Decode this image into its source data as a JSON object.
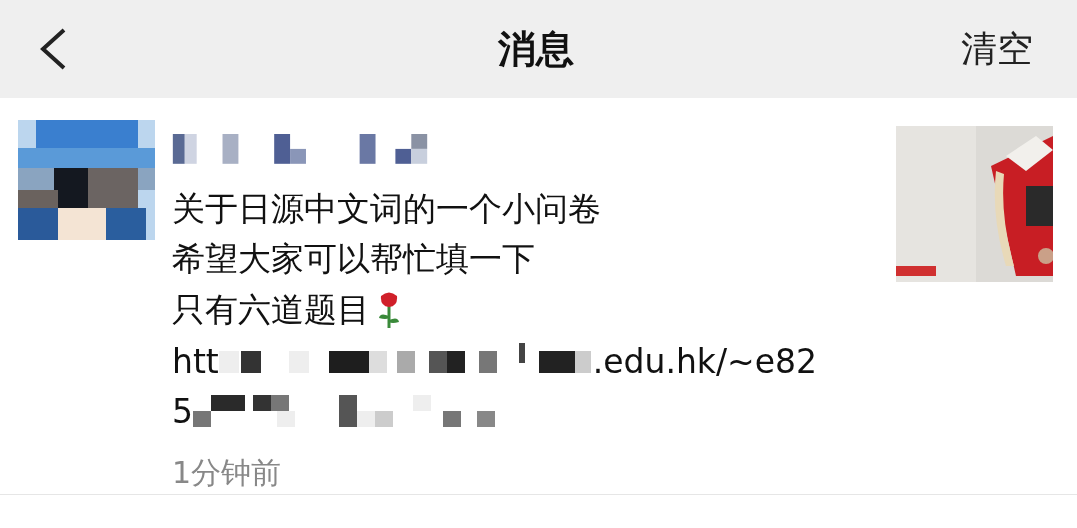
{
  "header": {
    "title": "消息",
    "action": "清空"
  },
  "message": {
    "lines": [
      "关于日源中文词的一个小问卷",
      "希望大家可以帮忙填一下",
      "只有六道题目"
    ],
    "link_lines": [
      {
        "start": "htt",
        "end": ".edu.hk/~e82"
      },
      {
        "start": "5"
      }
    ],
    "time": "1分钟前"
  }
}
